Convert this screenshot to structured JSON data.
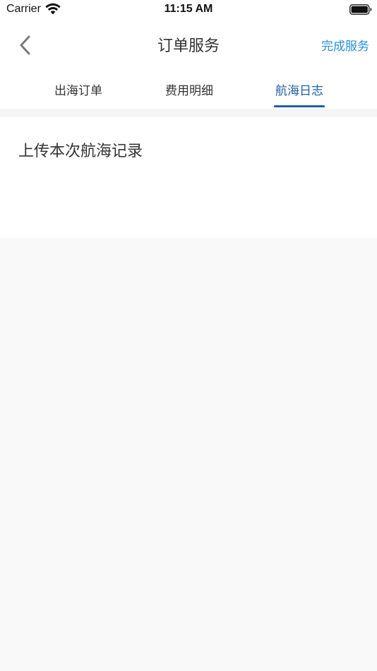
{
  "status_bar": {
    "carrier": "Carrier",
    "time": "11:15 AM",
    "icons": [
      "wifi-icon",
      "battery-icon"
    ]
  },
  "nav": {
    "title": "订单服务",
    "done_label": "完成服务",
    "back_icon": "chevron-left-icon"
  },
  "tabs": [
    {
      "label": "出海订单",
      "active": false
    },
    {
      "label": "费用明细",
      "active": false
    },
    {
      "label": "航海日志",
      "active": true
    }
  ],
  "content": {
    "upload_label": "上传本次航海记录"
  },
  "colors": {
    "accent": "#2a8fd8",
    "active_tab": "#1f5fa8",
    "text": "#333333",
    "background": "#f9f9f9"
  }
}
